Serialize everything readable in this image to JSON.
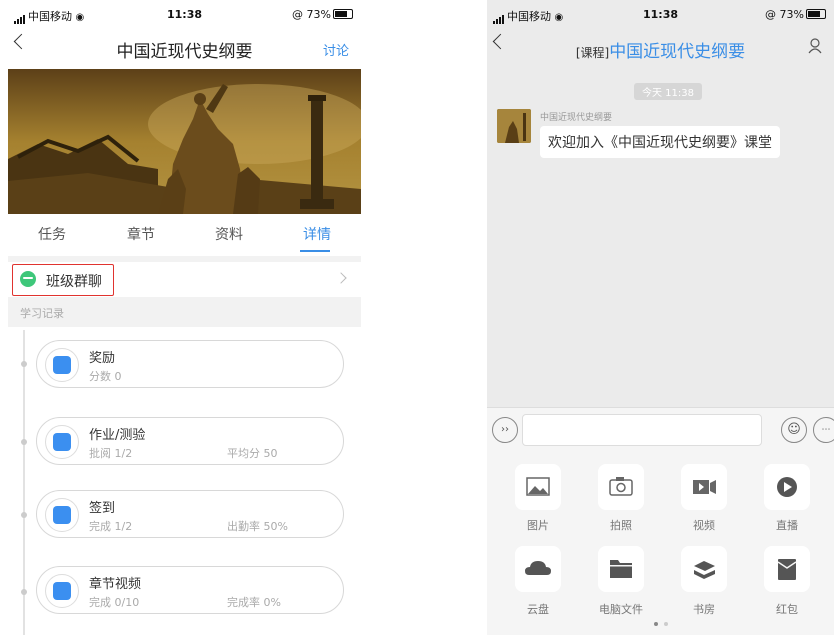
{
  "left": {
    "status": {
      "carrier": "中国移动",
      "time": "11:38",
      "battery": "73%"
    },
    "nav": {
      "title": "中国近现代史纲要",
      "action": "讨论"
    },
    "tabs": [
      {
        "label": "任务"
      },
      {
        "label": "章节"
      },
      {
        "label": "资料"
      },
      {
        "label": "详情",
        "active": true
      }
    ],
    "group_chat": {
      "label": "班级群聊"
    },
    "record_label": "学习记录",
    "records": [
      {
        "title": "奖励",
        "sub": "分数 0",
        "sub2": "",
        "icon": "award-icon"
      },
      {
        "title": "作业/测验",
        "sub": "批阅 1/2",
        "sub2": "平均分 50",
        "icon": "homework-icon"
      },
      {
        "title": "签到",
        "sub": "完成 1/2",
        "sub2": "出勤率 50%",
        "icon": "checkin-icon"
      },
      {
        "title": "章节视频",
        "sub": "完成 0/10",
        "sub2": "完成率 0%",
        "icon": "video-list-icon"
      }
    ]
  },
  "right": {
    "status": {
      "carrier": "中国移动",
      "time": "11:38",
      "battery": "73%"
    },
    "nav": {
      "tag": "[课程]",
      "title": "中国近现代史纲要"
    },
    "timestamp": "今天 11:38",
    "message": {
      "sender": "中国近现代史纲要",
      "text": "欢迎加入《中国近现代史纲要》课堂"
    },
    "tools": [
      {
        "label": "图片",
        "icon": "image-icon"
      },
      {
        "label": "拍照",
        "icon": "camera-icon"
      },
      {
        "label": "视频",
        "icon": "video-icon"
      },
      {
        "label": "直播",
        "icon": "live-icon"
      },
      {
        "label": "云盘",
        "icon": "cloud-icon"
      },
      {
        "label": "电脑文件",
        "icon": "folder-icon"
      },
      {
        "label": "书房",
        "icon": "bookshelf-icon"
      },
      {
        "label": "红包",
        "icon": "red-packet-icon"
      }
    ]
  },
  "colors": {
    "accent": "#3a8ee6",
    "highlight_box": "#e0332f",
    "chat_green": "#3ec77a"
  }
}
